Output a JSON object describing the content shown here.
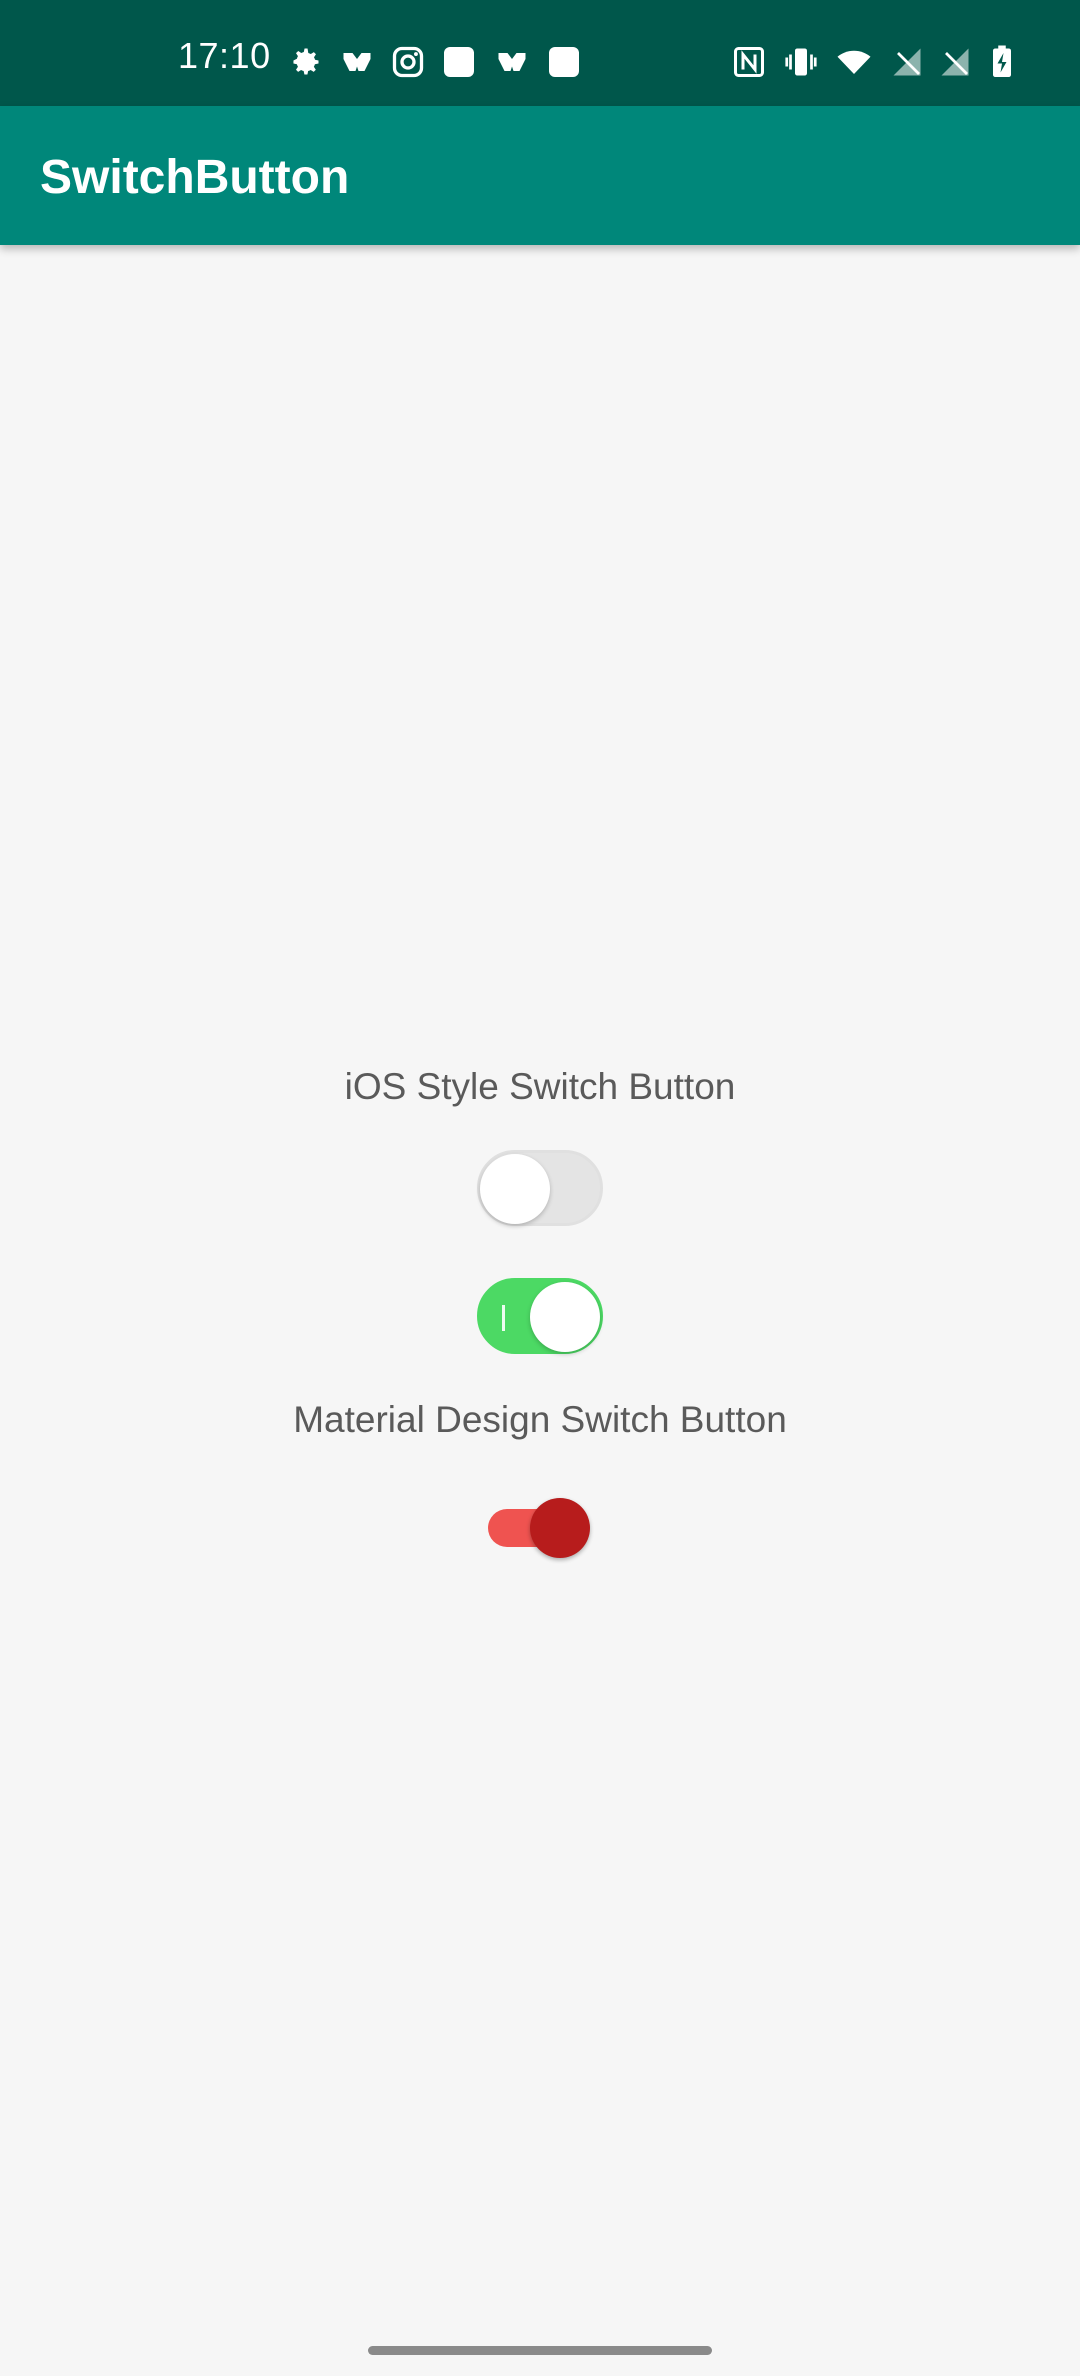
{
  "status_bar": {
    "time": "17:10",
    "left_icons": [
      "gear-icon",
      "app-icon",
      "instagram-icon",
      "square-app-icon",
      "app-icon",
      "square-app-icon"
    ],
    "right_icons": [
      "nfc-icon",
      "vibrate-icon",
      "wifi-icon",
      "signal-icon",
      "signal-icon",
      "battery-charging-icon"
    ]
  },
  "app_bar": {
    "title": "SwitchButton",
    "color": "#00877a"
  },
  "main": {
    "ios_section_label": "iOS Style Switch Button",
    "ios_switches": [
      {
        "state": "off"
      },
      {
        "state": "on",
        "color": "#4cd964"
      }
    ],
    "material_section_label": "Material Design Switch Button",
    "material_switch": {
      "state": "on",
      "track_color": "#ef5350",
      "thumb_color": "#b71c1c"
    }
  }
}
